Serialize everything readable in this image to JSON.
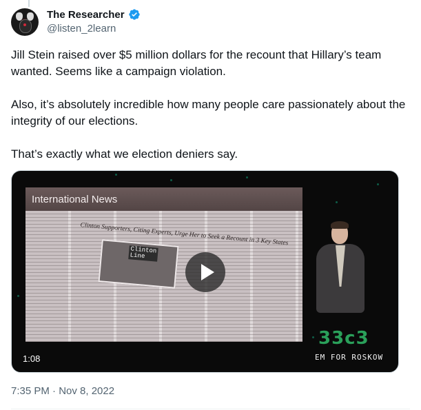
{
  "author": {
    "display_name": "The Researcher",
    "handle": "@listen_2learn",
    "verified": true,
    "avatar_icon": "devil-mask-avatar"
  },
  "tweet": {
    "paragraphs": [
      "Jill Stein raised over $5 million dollars for the recount that Hillary’s team wanted. Seems like a campaign violation.",
      "Also, it’s absolutely incredible how many people care passionately about the integrity of our elections.",
      "That’s exactly what we election deniers say."
    ],
    "timestamp": "7:35 PM · Nov 8, 2022"
  },
  "video": {
    "banner": "International News",
    "newspaper_headline": "Clinton Supporters, Citing Experts, Urge Her to Seek a Recount in 3 Key States",
    "photo_caption": "Clinton\nLine",
    "logo": "33c3",
    "logo_mirrored": "EM FOR ROSKOW",
    "duration": "1:08",
    "play_icon": "play-icon"
  },
  "colors": {
    "verified_blue": "#1d9bf0",
    "muted_text": "#536471",
    "logo_green": "#2aa05a"
  }
}
